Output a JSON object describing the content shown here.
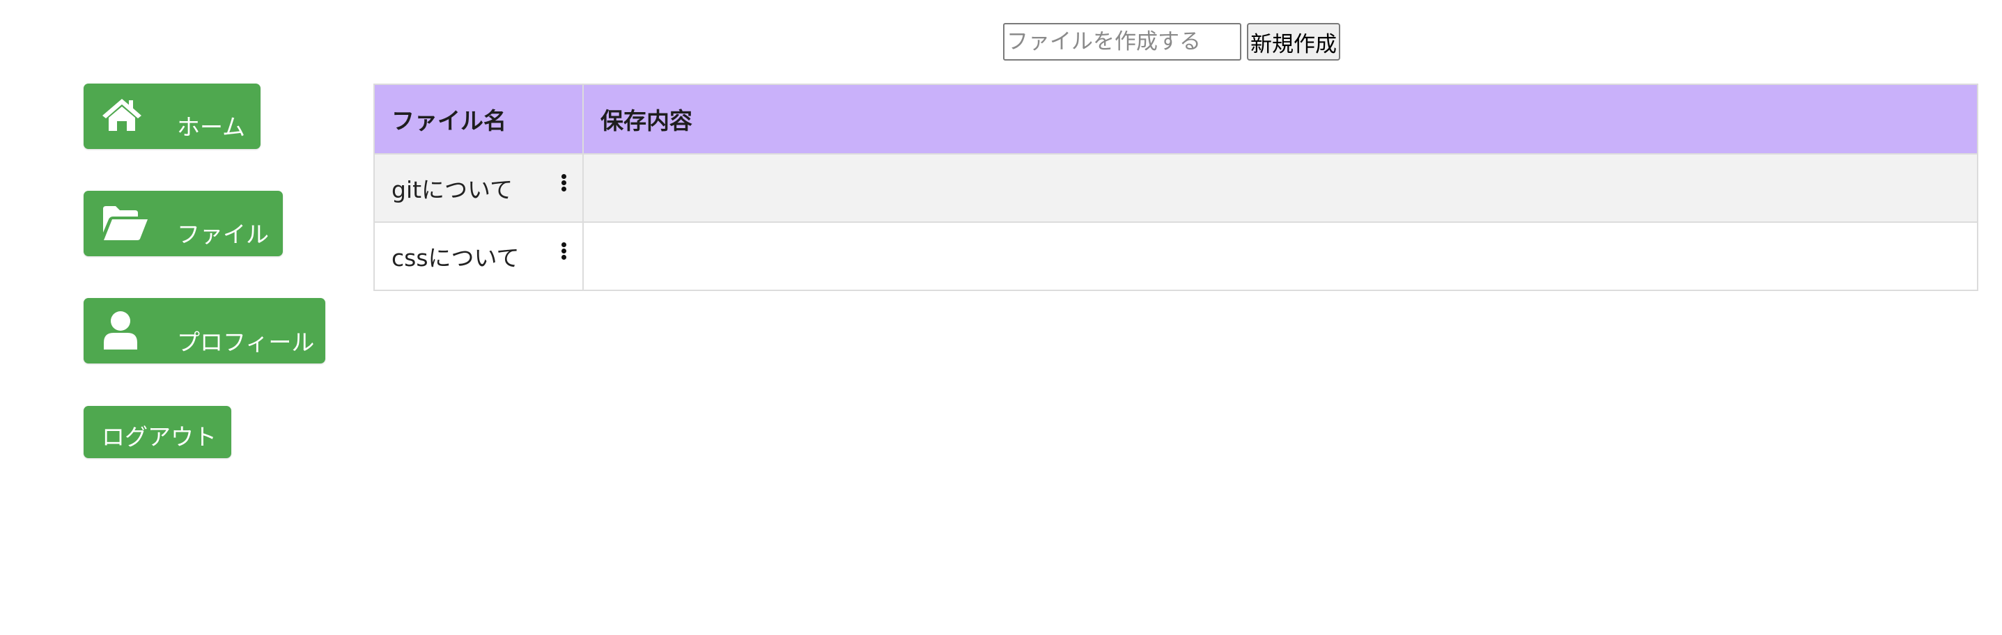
{
  "create": {
    "placeholder": "ファイルを作成する",
    "value": "",
    "button_label": "新規作成"
  },
  "sidebar": {
    "items": [
      {
        "label": "ホーム",
        "icon": "home-icon"
      },
      {
        "label": "ファイル",
        "icon": "folder-open-icon"
      },
      {
        "label": "プロフィール",
        "icon": "user-icon"
      },
      {
        "label": "ログアウト",
        "icon": ""
      }
    ]
  },
  "table": {
    "headers": [
      "ファイル名",
      "保存内容"
    ],
    "rows": [
      {
        "name": "gitについて",
        "content": "",
        "menu_icon": "more-vertical-icon"
      },
      {
        "name": "cssについて",
        "content": "",
        "menu_icon": "more-vertical-icon"
      }
    ]
  },
  "colors": {
    "button_green": "#4fa84f",
    "header_purple": "#c9b1fa",
    "row_alt": "#f2f2f2"
  }
}
